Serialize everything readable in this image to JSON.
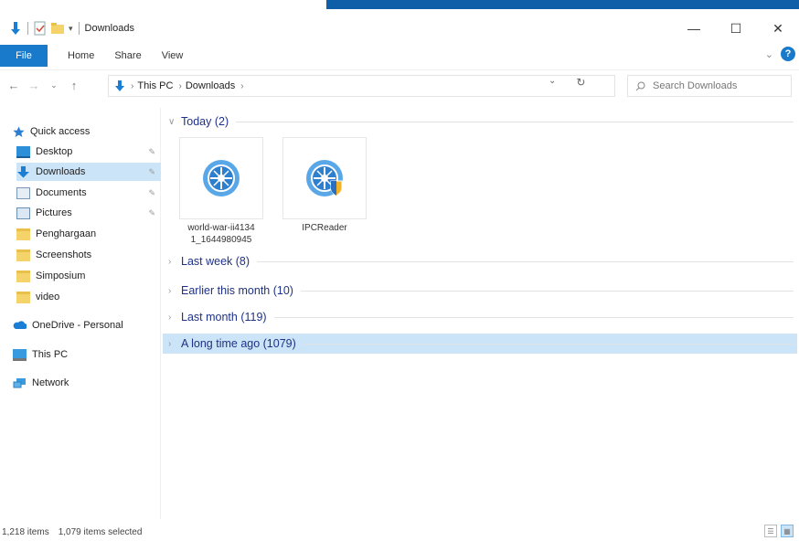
{
  "window": {
    "title": "Downloads",
    "minimize_glyph": "—",
    "maximize_glyph": "☐",
    "close_glyph": "✕"
  },
  "ribbon": {
    "tabs": [
      "File",
      "Home",
      "Share",
      "View"
    ],
    "collapse_glyph": "⌄",
    "help_glyph": "?"
  },
  "address": {
    "crumbs": [
      "This PC",
      "Downloads"
    ],
    "search_placeholder": "Search Downloads"
  },
  "sidebar": {
    "quick_access": "Quick access",
    "items": [
      {
        "label": "Desktop",
        "pinned": true
      },
      {
        "label": "Downloads",
        "pinned": true
      },
      {
        "label": "Documents",
        "pinned": true
      },
      {
        "label": "Pictures",
        "pinned": true
      },
      {
        "label": "Penghargaan",
        "pinned": false
      },
      {
        "label": "Screenshots",
        "pinned": false
      },
      {
        "label": "Simposium",
        "pinned": false
      },
      {
        "label": "video",
        "pinned": false
      }
    ],
    "onedrive": "OneDrive - Personal",
    "this_pc": "This PC",
    "network": "Network"
  },
  "groups": [
    {
      "title": "Today (2)",
      "expanded": true
    },
    {
      "title": "Last week (8)",
      "expanded": false
    },
    {
      "title": "Earlier this month (10)",
      "expanded": false
    },
    {
      "title": "Last month (119)",
      "expanded": false
    },
    {
      "title": "A long time ago (1079)",
      "expanded": false,
      "selected": true
    }
  ],
  "files": [
    {
      "name_line1": "world-war-ii4134",
      "name_line2": "1_1644980945",
      "icon": "app-compass-icon"
    },
    {
      "name_line1": "IPCReader",
      "name_line2": "",
      "icon": "app-compass-shield-icon"
    }
  ],
  "status": {
    "item_count": "1,218 items",
    "selected_count": "1,079 items selected"
  },
  "colors": {
    "accent": "#0e5fa8",
    "file_tab": "#1979ca",
    "selection": "#cce4f7",
    "group_title": "#1e3287"
  }
}
